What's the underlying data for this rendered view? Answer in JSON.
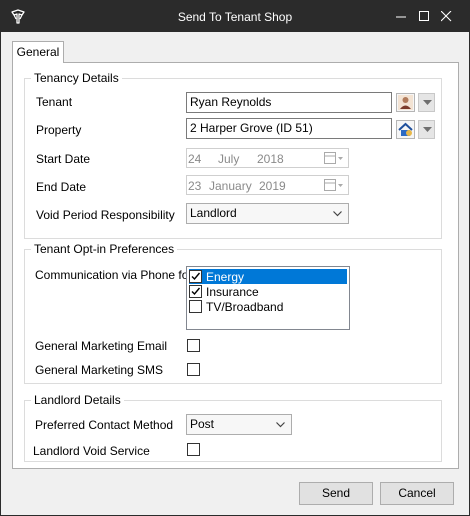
{
  "window": {
    "title": "Send To Tenant Shop",
    "controls": {
      "minimize": "minimize-icon",
      "maximize": "maximize-icon",
      "close": "close-icon"
    }
  },
  "tabs": [
    {
      "label": "General",
      "selected": true
    }
  ],
  "tenancy": {
    "title": "Tenancy Details",
    "tenant_label": "Tenant",
    "tenant_value": "Ryan Reynolds",
    "property_label": "Property",
    "property_value": "2 Harper Grove (ID 51)",
    "start_label": "Start Date",
    "start_day": "24",
    "start_month": "July",
    "start_year": "2018",
    "end_label": "End Date",
    "end_day": "23",
    "end_month": "January",
    "end_year": "2019",
    "void_label": "Void Period Responsibility",
    "void_value": "Landlord"
  },
  "optin": {
    "title": "Tenant Opt-in Preferences",
    "phone_label": "Communication via Phone for:",
    "phone_options": [
      {
        "label": "Energy",
        "checked": true,
        "selected": true
      },
      {
        "label": "Insurance",
        "checked": true,
        "selected": false
      },
      {
        "label": "TV/Broadband",
        "checked": false,
        "selected": false
      }
    ],
    "email_label": "General Marketing Email",
    "email_checked": false,
    "sms_label": "General Marketing SMS",
    "sms_checked": false
  },
  "landlord": {
    "title": "Landlord Details",
    "contact_label": "Preferred Contact Method",
    "contact_value": "Post",
    "void_service_label": "Landlord Void Service",
    "void_service_checked": false
  },
  "actions": {
    "send_label": "Send",
    "cancel_label": "Cancel"
  },
  "colors": {
    "titlebar": "#2b2b2b",
    "selection": "#0078d7",
    "panel": "#ffffff",
    "window": "#f0f0f0"
  }
}
